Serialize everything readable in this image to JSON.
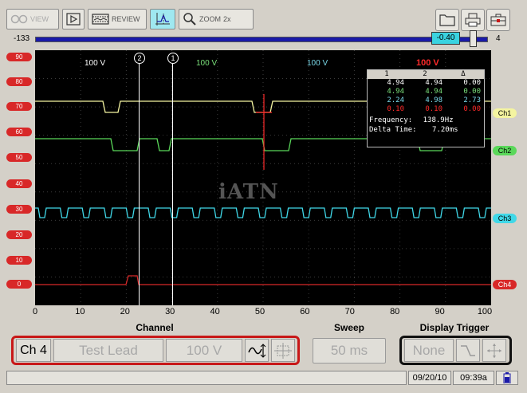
{
  "toolbar": {
    "view_label": "VIEW",
    "review_label": "REVIEW",
    "zoom_label": "ZOOM",
    "zoom_level": "2x"
  },
  "slider": {
    "min": "-133",
    "max": "4",
    "value": "-0.40"
  },
  "scope": {
    "y_axis": [
      "90",
      "80",
      "70",
      "60",
      "50",
      "40",
      "30",
      "20",
      "10",
      "0"
    ],
    "x_axis": [
      "0",
      "10",
      "20",
      "30",
      "40",
      "50",
      "60",
      "70",
      "80",
      "90",
      "100"
    ],
    "scale_labels": [
      {
        "text": "100 V",
        "color": "#ffffff"
      },
      {
        "text": "100 V",
        "color": "#7ae07a"
      },
      {
        "text": "100 V",
        "color": "#7ad8e8"
      },
      {
        "text": "100 V",
        "color": "#ff2a2a"
      }
    ],
    "cursor1": "1",
    "cursor2": "2",
    "watermark": "iATN",
    "readout": {
      "headers": [
        "1",
        "2",
        "Δ"
      ],
      "rows": [
        {
          "v1": "4.94",
          "v2": "4.94",
          "d": "0.00",
          "color": "#ffffff"
        },
        {
          "v1": "4.94",
          "v2": "4.94",
          "d": "0.00",
          "color": "#7ae07a"
        },
        {
          "v1": "2.24",
          "v2": "4.98",
          "d": "2.73",
          "color": "#7ad8e8"
        },
        {
          "v1": "0.10",
          "v2": "0.10",
          "d": "0.00",
          "color": "#ff2a2a"
        }
      ],
      "frequency_label": "Frequency:",
      "frequency_value": "138.9Hz",
      "delta_label": "Delta Time:",
      "delta_value": "7.20ms"
    },
    "channels": [
      {
        "label": "Ch1",
        "color": "#f4f4a0"
      },
      {
        "label": "Ch2",
        "color": "#5ad85a"
      },
      {
        "label": "Ch3",
        "color": "#40d8e8"
      },
      {
        "label": "Ch4",
        "color": "#d82828"
      }
    ]
  },
  "bottom": {
    "channel_title": "Channel",
    "sweep_title": "Sweep",
    "trigger_title": "Display Trigger",
    "channel_select": "Ch 4",
    "lead_type": "Test Lead",
    "scale": "100 V",
    "sweep_value": "50 ms",
    "trigger_value": "None"
  },
  "status": {
    "date": "09/20/10",
    "time": "09:39a"
  }
}
